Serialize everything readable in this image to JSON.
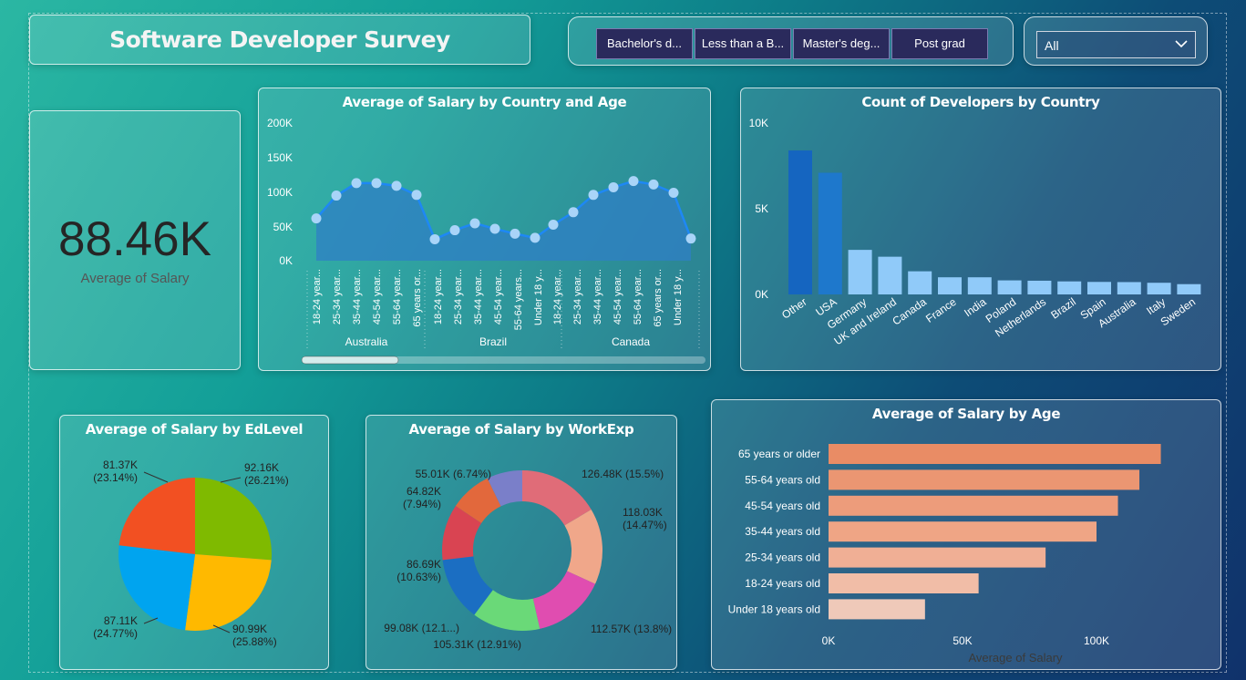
{
  "title": "Software Developer Survey",
  "slicer": {
    "buttons": [
      "Bachelor's d...",
      "Less than a B...",
      "Master's deg...",
      "Post grad"
    ],
    "dropdown_value": "All"
  },
  "kpi": {
    "value": "88.46K",
    "label": "Average of Salary"
  },
  "charts": {
    "salary_country_age": {
      "title": "Average of Salary by Country and Age",
      "y_ticks": [
        "200K",
        "150K",
        "100K",
        "50K",
        "0K"
      ],
      "x_labels": [
        "18-24 year...",
        "25-34 year...",
        "35-44 year...",
        "45-54 year...",
        "55-64 year...",
        "65 years or...",
        "18-24 year...",
        "25-34 year...",
        "35-44 year...",
        "45-54 year...",
        "55-64 years...",
        "Under 18 y...",
        "18-24 year...",
        "25-34 year...",
        "35-44 year...",
        "45-54 year...",
        "55-64 year...",
        "65 years or...",
        "Under 18 y..."
      ],
      "groups": [
        "Australia",
        "Brazil",
        "Canada"
      ]
    },
    "dev_count_country": {
      "title": "Count of Developers by Country",
      "y_ticks": [
        "10K",
        "5K",
        "0K"
      ]
    },
    "salary_edlevel": {
      "title": "Average of Salary by EdLevel",
      "labels": [
        [
          "92.16K",
          "(26.21%)"
        ],
        [
          "90.99K",
          "(25.88%)"
        ],
        [
          "87.11K",
          "(24.77%)"
        ],
        [
          "81.37K",
          "(23.14%)"
        ]
      ]
    },
    "salary_workexp": {
      "title": "Average of Salary by WorkExp",
      "labels": [
        [
          "126.48K (15.5%)"
        ],
        [
          "118.03K",
          "(14.47%)"
        ],
        [
          "112.57K (13.8%)"
        ],
        [
          "105.31K (12.91%)"
        ],
        [
          "99.08K (12.1...)"
        ],
        [
          "86.69K",
          "(10.63%)"
        ],
        [
          "64.82K",
          "(7.94%)"
        ],
        [
          "55.01K (6.74%)"
        ]
      ]
    },
    "salary_age": {
      "title": "Average of Salary by Age",
      "x_ticks": [
        "0K",
        "50K",
        "100K"
      ],
      "xlabel": "Average of Salary"
    }
  },
  "chart_data": [
    {
      "type": "area",
      "title": "Average of Salary by Country and Age",
      "categories": [
        "Australia 18-24",
        "Australia 25-34",
        "Australia 35-44",
        "Australia 45-54",
        "Australia 55-64",
        "Australia 65+",
        "Brazil 18-24",
        "Brazil 25-34",
        "Brazil 35-44",
        "Brazil 45-54",
        "Brazil 55-64",
        "Brazil Under 18",
        "Canada 18-24",
        "Canada 25-34",
        "Canada 35-44",
        "Canada 45-54",
        "Canada 55-64",
        "Canada 65+",
        "Canada Under 18"
      ],
      "values": [
        61000,
        94000,
        112000,
        112000,
        108000,
        95000,
        31000,
        44000,
        54000,
        46000,
        39000,
        33000,
        52000,
        70000,
        95000,
        106000,
        115000,
        110000,
        98000,
        32000
      ],
      "ylim": [
        0,
        200000
      ]
    },
    {
      "type": "bar",
      "title": "Count of Developers by Country",
      "categories": [
        "Other",
        "USA",
        "Germany",
        "UK and Ireland",
        "Canada",
        "France",
        "India",
        "Poland",
        "Netherlands",
        "Brazil",
        "Spain",
        "Australia",
        "Italy",
        "Sweden"
      ],
      "values": [
        8400,
        7100,
        2600,
        2200,
        1350,
        1000,
        1000,
        820,
        800,
        760,
        730,
        720,
        680,
        600
      ],
      "colors": [
        "#1565c0",
        "#1e78cc",
        "#90caf9",
        "#90caf9",
        "#90caf9",
        "#90caf9",
        "#90caf9",
        "#90caf9",
        "#90caf9",
        "#90caf9",
        "#90caf9",
        "#90caf9",
        "#90caf9",
        "#90caf9"
      ],
      "ylim": [
        0,
        10000
      ]
    },
    {
      "type": "pie",
      "title": "Average of Salary by EdLevel",
      "values": [
        92.16,
        90.99,
        87.11,
        81.37
      ],
      "percent": [
        26.21,
        25.88,
        24.77,
        23.14
      ],
      "colors": [
        "#7fba00",
        "#ffb900",
        "#00a4ef",
        "#f25022"
      ]
    },
    {
      "type": "pie",
      "title": "Average of Salary by WorkExp",
      "values": [
        126.48,
        118.03,
        112.57,
        105.31,
        99.08,
        86.69,
        64.82,
        55.01
      ],
      "percent": [
        15.5,
        14.47,
        13.8,
        12.91,
        12.1,
        10.63,
        7.94,
        6.74
      ],
      "colors": [
        "#e06c78",
        "#f0a78a",
        "#e04db0",
        "#6ad978",
        "#1b6ec2",
        "#d94452",
        "#e2683c",
        "#7a7fc9",
        "#c5a8e8"
      ]
    },
    {
      "type": "bar",
      "title": "Average of Salary by Age",
      "categories": [
        "65 years or older",
        "55-64 years old",
        "45-54 years old",
        "35-44 years old",
        "25-34 years old",
        "18-24 years old",
        "Under 18 years old"
      ],
      "values": [
        124000,
        116000,
        108000,
        100000,
        81000,
        56000,
        36000
      ],
      "xlim": [
        0,
        150000
      ],
      "xlabel": "Average of Salary",
      "colors": [
        "#e98c65",
        "#eb9672",
        "#ed9c7b",
        "#efa585",
        "#f0af95",
        "#f1bda7",
        "#efc9b9"
      ]
    }
  ]
}
